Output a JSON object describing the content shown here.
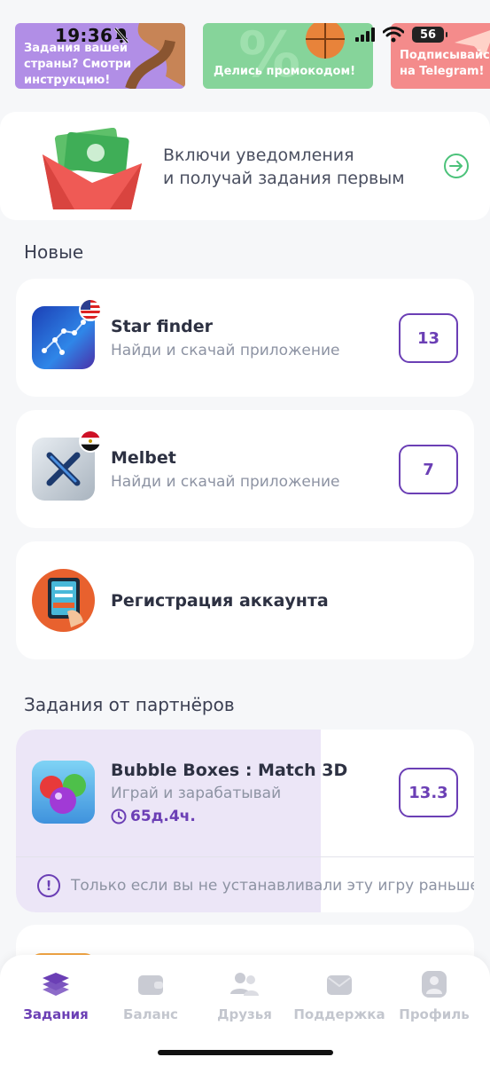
{
  "status_bar": {
    "time": "19:36",
    "battery": "56"
  },
  "banners": [
    {
      "text": "Задания вашей страны? Смотри инструкцию!",
      "color": "#b18ee6"
    },
    {
      "text": "Делись промокодом!",
      "color": "#86d49a"
    },
    {
      "text": "Подписывайся на Telegram!",
      "color": "#f48b8b"
    }
  ],
  "notification": {
    "line1": "Включи уведомления",
    "line2": "и получай задания первым"
  },
  "sections": {
    "new_title": "Новые",
    "partners_title": "Задания от партнёров"
  },
  "tasks": [
    {
      "title": "Star finder",
      "subtitle": "Найди и скачай приложение",
      "reward": "13",
      "icon": "star-finder-app-icon",
      "flag": "us-flag-icon"
    },
    {
      "title": "Melbet",
      "subtitle": "Найди и скачай приложение",
      "reward": "7",
      "icon": "melbet-app-icon",
      "flag": "egypt-flag-icon"
    },
    {
      "title": "Регистрация аккаунта",
      "icon": "registration-icon"
    }
  ],
  "partner_task": {
    "title": "Bubble Boxes : Match 3D",
    "subtitle": "Играй и зарабатывай",
    "timer": "65д.4ч.",
    "reward": "13.3",
    "note": "Только если вы не устанавливали эту игру раньше"
  },
  "tabbar": [
    {
      "label": "Задания",
      "icon": "tasks-icon",
      "active": true
    },
    {
      "label": "Баланс",
      "icon": "wallet-icon",
      "active": false
    },
    {
      "label": "Друзья",
      "icon": "friends-icon",
      "active": false
    },
    {
      "label": "Поддержка",
      "icon": "support-icon",
      "active": false
    },
    {
      "label": "Профиль",
      "icon": "profile-icon",
      "active": false
    }
  ],
  "colors": {
    "accent": "#6b3fb5",
    "background": "#f6f7f9",
    "muted_text": "#8d93a3",
    "highlight": "#ece6f7"
  }
}
